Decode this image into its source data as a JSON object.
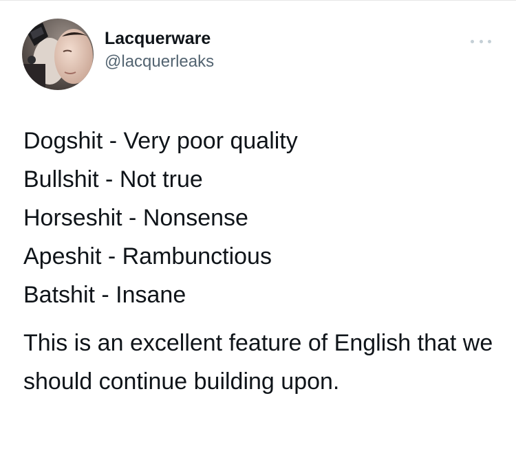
{
  "tweet": {
    "display_name": "Lacquerware",
    "handle": "@lacquerleaks",
    "avatar_icon": "user-avatar-photo",
    "more_icon": "more-horizontal-icon",
    "lines": [
      "Dogshit - Very poor quality",
      "Bullshit - Not true",
      "Horseshit - Nonsense",
      "Apeshit - Rambunctious",
      "Batshit - Insane"
    ],
    "closing": "This is an excellent feature of English that we should continue building upon."
  },
  "colors": {
    "text": "#0f1419",
    "secondary_text": "#536471",
    "more_icon": "#c4cfd6",
    "background": "#ffffff"
  }
}
